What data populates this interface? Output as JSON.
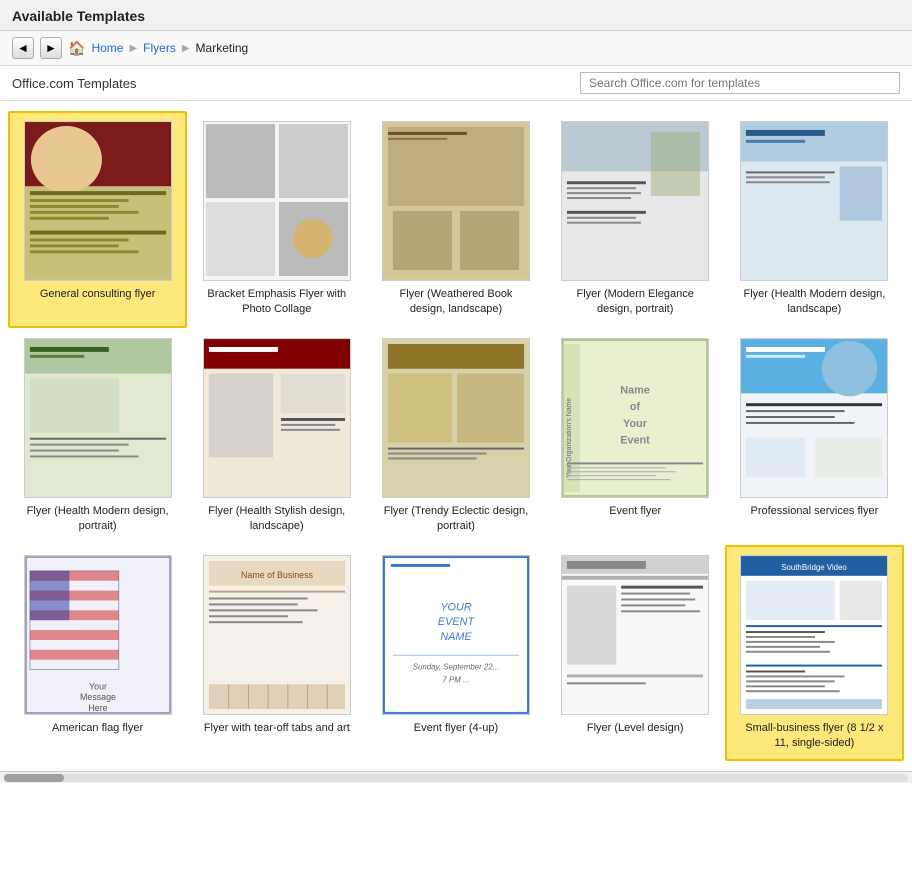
{
  "page": {
    "title": "Available Templates"
  },
  "nav": {
    "back_label": "◄",
    "forward_label": "►",
    "home_icon": "🏠",
    "breadcrumbs": [
      "Home",
      "Flyers",
      "Marketing"
    ]
  },
  "toolbar": {
    "source_label": "Office.com Templates",
    "search_placeholder": "Search Office.com for templates"
  },
  "templates": [
    {
      "id": "general-consulting",
      "label": "General consulting flyer",
      "selected": true,
      "thumb_type": "consulting"
    },
    {
      "id": "bracket-emphasis",
      "label": "Bracket Emphasis Flyer with Photo Collage",
      "selected": false,
      "thumb_type": "bracket"
    },
    {
      "id": "weathered-book",
      "label": "Flyer (Weathered Book design, landscape)",
      "selected": false,
      "thumb_type": "weathered"
    },
    {
      "id": "modern-elegance",
      "label": "Flyer (Modern Elegance design, portrait)",
      "selected": false,
      "thumb_type": "modern-elegance"
    },
    {
      "id": "health-modern-ls",
      "label": "Flyer (Health Modern design, landscape)",
      "selected": false,
      "thumb_type": "health-modern-ls"
    },
    {
      "id": "health-modern-pt",
      "label": "Flyer (Health Modern design, portrait)",
      "selected": false,
      "thumb_type": "health-modern-pt"
    },
    {
      "id": "health-stylish",
      "label": "Flyer (Health Stylish design, landscape)",
      "selected": false,
      "thumb_type": "health-stylish"
    },
    {
      "id": "trendy-eclectic",
      "label": "Flyer (Trendy Eclectic design, portrait)",
      "selected": false,
      "thumb_type": "trendy"
    },
    {
      "id": "event-flyer",
      "label": "Event flyer",
      "selected": false,
      "thumb_type": "event"
    },
    {
      "id": "professional-services",
      "label": "Professional services flyer",
      "selected": false,
      "thumb_type": "professional"
    },
    {
      "id": "american-flag",
      "label": "American flag flyer",
      "selected": false,
      "thumb_type": "american-flag"
    },
    {
      "id": "tearoff-tabs",
      "label": "Flyer with tear-off tabs and art",
      "selected": false,
      "thumb_type": "tearoff"
    },
    {
      "id": "event-4up",
      "label": "Event flyer (4-up)",
      "selected": false,
      "thumb_type": "event-4up"
    },
    {
      "id": "level-design",
      "label": "Flyer (Level design)",
      "selected": false,
      "thumb_type": "level"
    },
    {
      "id": "small-biz",
      "label": "Small-business flyer (8 1/2 x 11, single-sided)",
      "selected": true,
      "thumb_type": "small-biz"
    }
  ]
}
